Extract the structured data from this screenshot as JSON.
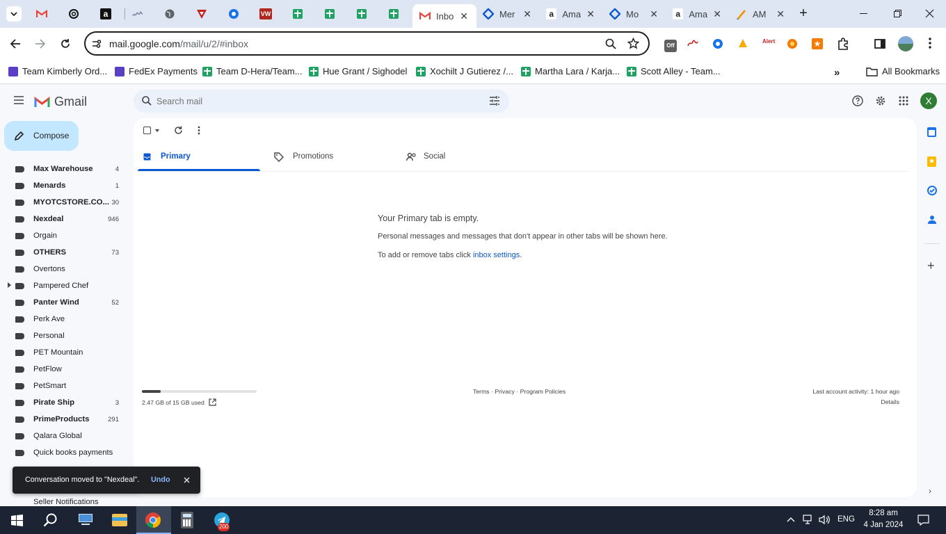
{
  "browser": {
    "tabs": [
      {
        "title": "Inbo",
        "active": true
      },
      {
        "title": "Mer"
      },
      {
        "title": "Ama"
      },
      {
        "title": "Mo"
      },
      {
        "title": "Ama"
      },
      {
        "title": "AM"
      }
    ],
    "url_host": "mail.google.com",
    "url_path": "/mail/u/2/#inbox",
    "bookmarks": [
      "Team Kimberly Ord...",
      "FedEx Payments",
      "Team D-Hera/Team...",
      "Hue Grant / Sighodel",
      "Xochilt J Gutierez /...",
      "Martha Lara / Karja...",
      "Scott Alley - Team..."
    ],
    "all_bookmarks": "All Bookmarks"
  },
  "gmail": {
    "brand": "Gmail",
    "search_placeholder": "Search mail",
    "compose": "Compose",
    "avatar_letter": "X",
    "labels": [
      {
        "name": "Max Warehouse",
        "count": "4",
        "bold": true
      },
      {
        "name": "Menards",
        "count": "1",
        "bold": true
      },
      {
        "name": "MYOTCSTORE.CO...",
        "count": "30",
        "bold": true
      },
      {
        "name": "Nexdeal",
        "count": "946",
        "bold": true
      },
      {
        "name": "Orgain",
        "count": ""
      },
      {
        "name": "OTHERS",
        "count": "73",
        "bold": true
      },
      {
        "name": "Overtons",
        "count": ""
      },
      {
        "name": "Pampered Chef",
        "count": "",
        "expand": true
      },
      {
        "name": "Panter Wind",
        "count": "52",
        "bold": true
      },
      {
        "name": "Perk Ave",
        "count": ""
      },
      {
        "name": "Personal",
        "count": ""
      },
      {
        "name": "PET Mountain",
        "count": ""
      },
      {
        "name": "PetFlow",
        "count": ""
      },
      {
        "name": "PetSmart",
        "count": ""
      },
      {
        "name": "Pirate Ship",
        "count": "3",
        "bold": true
      },
      {
        "name": "PrimeProducts",
        "count": "291",
        "bold": true
      },
      {
        "name": "Qalara Global",
        "count": ""
      },
      {
        "name": "Quick books payments",
        "count": ""
      }
    ],
    "last_label": "Seller Notifications",
    "tabs": [
      "Primary",
      "Promotions",
      "Social"
    ],
    "empty_title": "Your Primary tab is empty.",
    "empty_desc": "Personal messages and messages that don't appear in other tabs will be shown here.",
    "empty_hint_prefix": "To add or remove tabs click ",
    "empty_hint_link": "inbox settings",
    "empty_hint_suffix": ".",
    "storage": "2.47 GB of 15 GB used",
    "storage_fraction": 0.165,
    "footer_links": "Terms · Privacy · Program Policies",
    "last_activity": "Last account activity: 1 hour ago",
    "details": "Details",
    "toast_msg": "Conversation moved to \"Nexdeal\".",
    "toast_undo": "Undo"
  },
  "taskbar": {
    "lang": "ENG",
    "time": "8:28 am",
    "date": "4 Jan 2024",
    "telegram_badge": "200"
  },
  "colors": {
    "accent": "#0b57d0",
    "compose_bg": "#c2e7ff",
    "toast_bg": "#202124"
  }
}
